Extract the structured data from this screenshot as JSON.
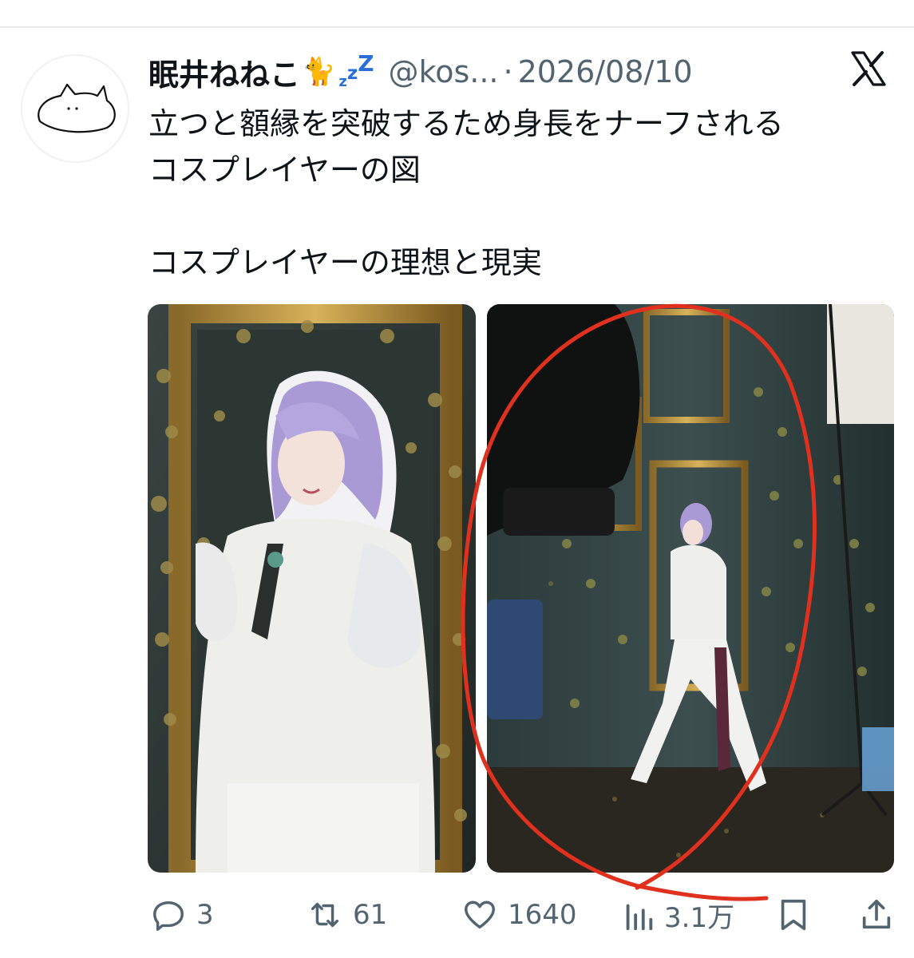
{
  "tweet": {
    "author": {
      "display_name": "眠井ねねこ",
      "name_emoji": "🐈",
      "sleep_glyphs": [
        "z",
        "z",
        "Z"
      ],
      "handle": "@kos...",
      "separator": "·",
      "date": "2026/08/10"
    },
    "platform_icon": "x-logo-icon",
    "text_lines": [
      "立つと額縁を突破するため身長をナーフされる",
      "コスプレイヤーの図",
      "",
      "コスプレイヤーの理想と現実"
    ],
    "media": [
      {
        "name": "cosplay-closeup-photo",
        "content": "photo"
      },
      {
        "name": "cosplay-studio-photo",
        "content": "photo"
      }
    ],
    "annotation_color": "#e0301e",
    "actions": {
      "reply": {
        "icon": "speech-bubble-icon",
        "count": "3"
      },
      "retweet": {
        "icon": "repost-arrows-icon",
        "count": "61"
      },
      "like": {
        "icon": "heart-icon",
        "count": "1640"
      },
      "views": {
        "icon": "bar-chart-icon",
        "count": "3.1万"
      },
      "bookmark": {
        "icon": "bookmark-icon"
      },
      "share": {
        "icon": "share-upload-icon"
      }
    }
  }
}
